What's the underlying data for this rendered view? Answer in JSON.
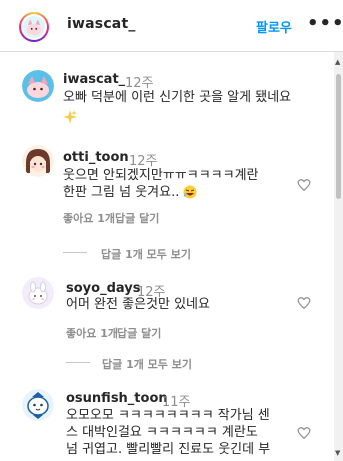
{
  "header": {
    "username": "iwascat_",
    "follow_label": "팔로우",
    "more_label": "•••"
  },
  "caption": {
    "username": "iwascat_",
    "time": "12주",
    "text": "오빠 덕분에 이런 신기한 곳을 알게 됐네요"
  },
  "comments": [
    {
      "username": "otti_toon",
      "time": "12주",
      "line1": "웃으면 안되겠지만ㅠㅠㅋㅋㅋㅋ계란",
      "line2": "한판 그림 넘 웃겨요..",
      "likes": "좋아요 1개",
      "reply": "답글 달기",
      "view_replies": "답글 1개 모두 보기"
    },
    {
      "username": "soyo_days",
      "time": "12주",
      "line1": "어머 완전 좋은것만 있네요",
      "likes": "좋아요 1개",
      "reply": "답글 달기",
      "view_replies": "답글 1개 모두 보기"
    },
    {
      "username": "osunfish_toon",
      "time": "11주",
      "line1": "오모오모 ㅋㅋㅋㅋㅋㅋㅋㅋ 작가님 센",
      "line2": "스 대박인걸요 ㅋㅋㅋㅋㅋㅋ 계란도",
      "line3": "넘 귀엽고. 빨리빨리 진료도 웃긴데 부"
    }
  ],
  "icons": {
    "heart": "heart-outline-icon",
    "sparkle": "sparkles-emoji",
    "laugh": "rofl-emoji",
    "scroll_up": "scroll-up-arrow-icon",
    "scroll_down": "scroll-down-arrow-icon"
  },
  "colors": {
    "accent": "#0095f6",
    "muted": "#8e8e8e",
    "text": "#262626"
  }
}
